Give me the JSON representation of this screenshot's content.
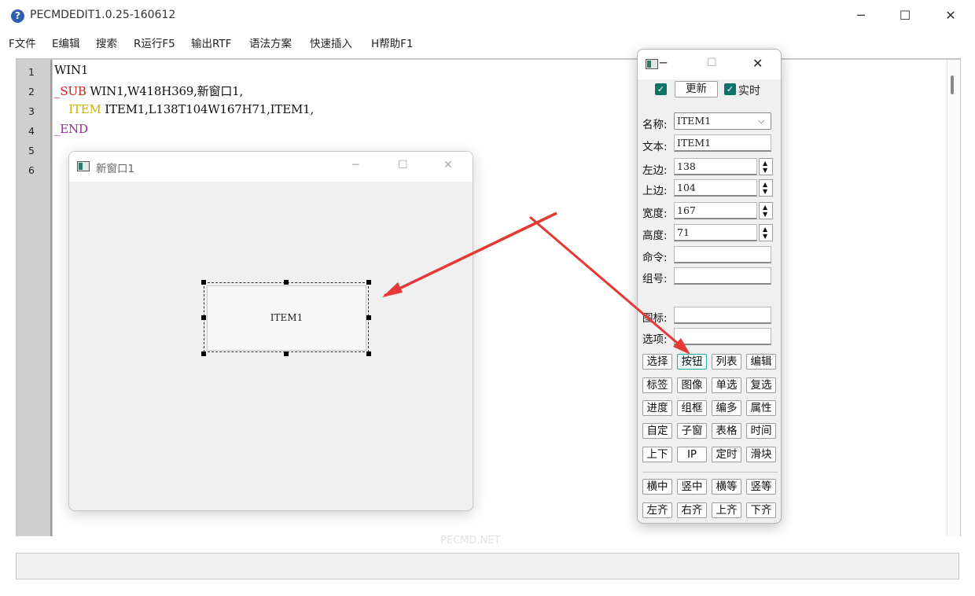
{
  "app": {
    "title": "PECMDEDIT1.0.25-160612",
    "icon": "help-icon",
    "window_controls": [
      "─",
      "☐",
      "✕"
    ]
  },
  "menu": [
    "F文件",
    "E编辑",
    "搜索",
    "R运行F5",
    "输出RTF",
    "语法方案",
    "快速插入",
    "H帮助F1"
  ],
  "editor": {
    "line_numbers": [
      "1",
      "2",
      "3",
      "4",
      "5",
      "6"
    ],
    "lines": [
      [
        {
          "t": "WIN1",
          "c": "#111111"
        }
      ],
      [
        {
          "t": "_SUB",
          "c": "#d02020"
        },
        {
          "t": " WIN1,W418H369,新窗口1,",
          "c": "#111111"
        }
      ],
      [
        {
          "t": "    ",
          "c": "#111111"
        },
        {
          "t": "ITEM",
          "c": "#c8b400"
        },
        {
          "t": " ITEM1,L138T104W167H71,ITEM1,",
          "c": "#111111"
        }
      ],
      [
        {
          "t": "_END",
          "c": "#9a2a9a"
        }
      ]
    ]
  },
  "preview": {
    "title": "新窗口1",
    "controls": [
      "─",
      "☐",
      "✕"
    ],
    "item_label": "ITEM1"
  },
  "panel": {
    "controls": [
      "─",
      "☐",
      "✕"
    ],
    "update_label": "更新",
    "realtime_label": "实时",
    "checkmark": "✓",
    "fields": {
      "name": {
        "label": "名称:",
        "value": "ITEM1"
      },
      "text": {
        "label": "文本:",
        "value": "ITEM1"
      },
      "left": {
        "label": "左边:",
        "value": "138"
      },
      "top": {
        "label": "上边:",
        "value": "104"
      },
      "width": {
        "label": "宽度:",
        "value": "167"
      },
      "height": {
        "label": "高度:",
        "value": "71"
      },
      "command": {
        "label": "命令:",
        "value": ""
      },
      "group": {
        "label": "组号:",
        "value": ""
      },
      "icon": {
        "label": "图标:",
        "value": ""
      },
      "option": {
        "label": "选项:",
        "value": ""
      }
    },
    "type_buttons": [
      "选择",
      "按钮",
      "列表",
      "编辑",
      "标签",
      "图像",
      "单选",
      "复选",
      "进度",
      "组框",
      "编多",
      "属性",
      "自定",
      "子窗",
      "表格",
      "时间",
      "上下",
      "IP",
      "定时",
      "滑块"
    ],
    "active_type": "按钮",
    "align_buttons": [
      "横中",
      "竖中",
      "横等",
      "竖等",
      "左齐",
      "右齐",
      "上齐",
      "下齐"
    ]
  },
  "watermark": "PECMD.NET",
  "colors": {
    "arrow": "#e53935",
    "accent": "#0e7467"
  }
}
